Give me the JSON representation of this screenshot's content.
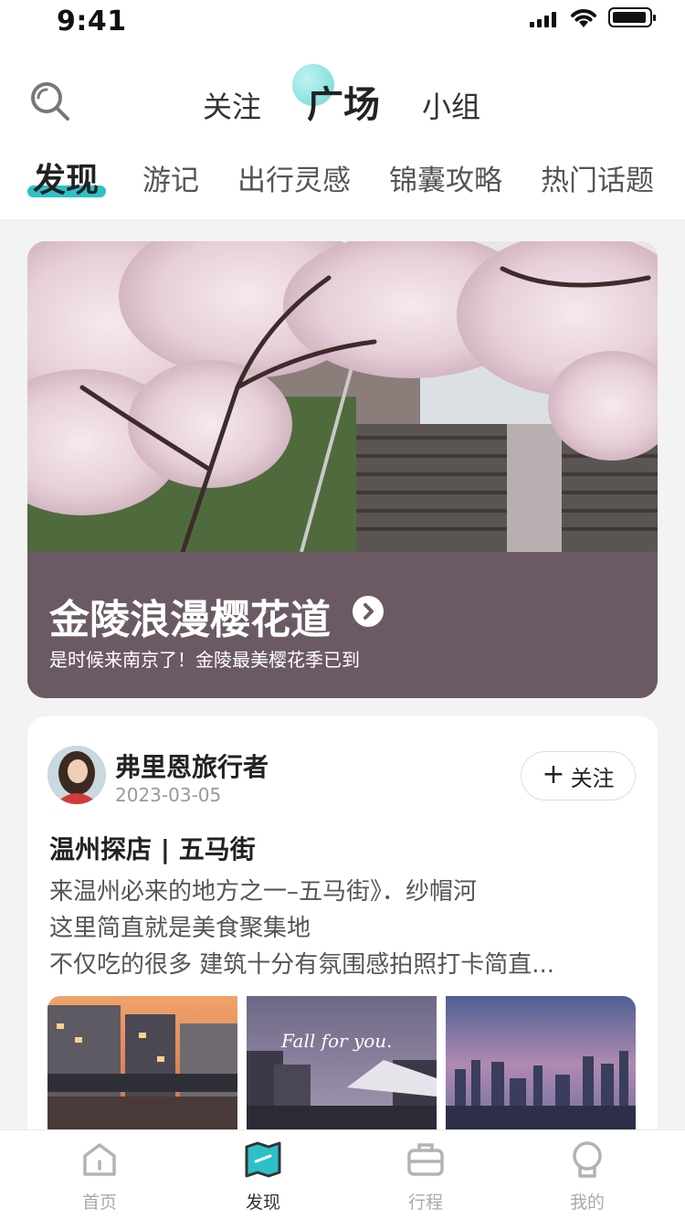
{
  "status_bar": {
    "time": "9:41"
  },
  "header": {
    "top_tabs": [
      {
        "label": "关注",
        "active": false
      },
      {
        "label": "广场",
        "active": true
      },
      {
        "label": "小组",
        "active": false
      }
    ],
    "sub_tabs": [
      {
        "label": "发现",
        "active": true
      },
      {
        "label": "游记",
        "active": false
      },
      {
        "label": "出行灵感",
        "active": false
      },
      {
        "label": "锦囊攻略",
        "active": false
      },
      {
        "label": "热门话题",
        "active": false
      }
    ],
    "accent_color": "#2ec0c7"
  },
  "banner": {
    "title": "金陵浪漫樱花道",
    "subtitle": "是时候来南京了！金陵最美樱花季已到",
    "image_icon": "cherry-blossom-photo",
    "footer_color": "#6b5a64"
  },
  "post": {
    "author": "弗里恩旅行者",
    "date": "2023-03-05",
    "follow_label": "关注",
    "title": "温州探店 | 五马街",
    "body_lines": [
      "来温州必来的地方之一–五马街》．纱帽河",
      "这里简直就是美食聚集地",
      "不仅吃的很多 建筑十分有氛围感拍照打卡简直..."
    ],
    "photos": [
      "city-sunset-photo",
      "fall-for-you-night-photo",
      "skyline-dusk-photo"
    ],
    "photo_caption": "Fall for you."
  },
  "tabbar": {
    "items": [
      {
        "label": "首页",
        "icon": "home-icon",
        "active": false
      },
      {
        "label": "发现",
        "icon": "map-icon",
        "active": true
      },
      {
        "label": "行程",
        "icon": "suitcase-icon",
        "active": false
      },
      {
        "label": "我的",
        "icon": "profile-icon",
        "active": false
      }
    ]
  }
}
